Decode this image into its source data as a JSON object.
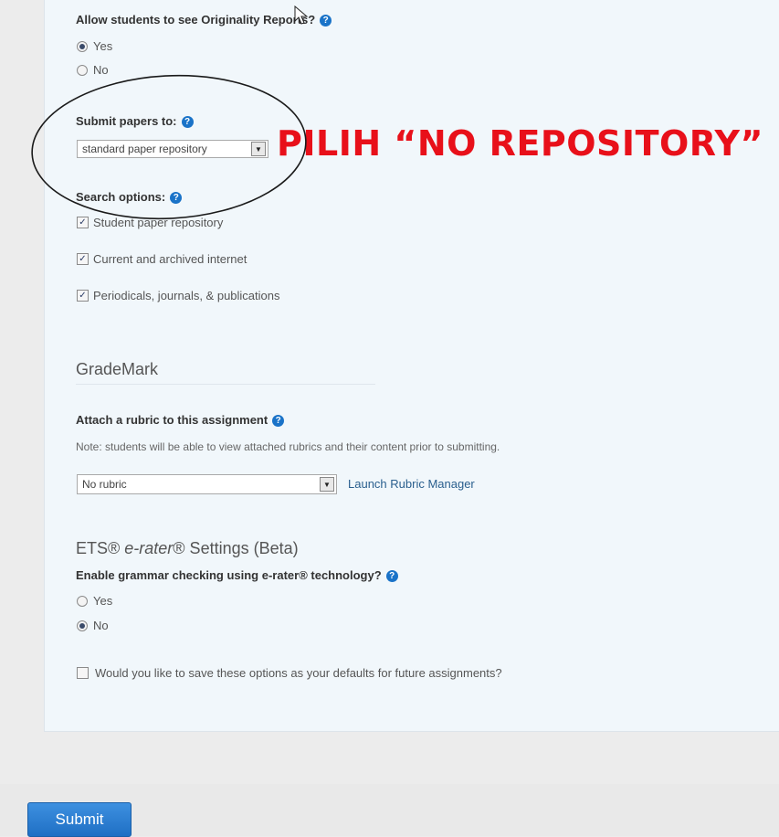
{
  "originality": {
    "question": "Allow students to see Originality Reports?",
    "options": [
      {
        "label": "Yes",
        "checked": true
      },
      {
        "label": "No",
        "checked": false
      }
    ]
  },
  "submit_papers": {
    "label": "Submit papers to:",
    "selected": "standard paper repository"
  },
  "annotation": {
    "text": "PILIH “NO REPOSITORY”",
    "color": "#e8101a"
  },
  "search_options": {
    "label": "Search options:",
    "items": [
      {
        "label": "Student paper repository",
        "checked": true
      },
      {
        "label": "Current and archived internet",
        "checked": true
      },
      {
        "label": "Periodicals, journals, & publications",
        "checked": true
      }
    ]
  },
  "grademark": {
    "title": "GradeMark",
    "rubric_label": "Attach a rubric to this assignment",
    "note": "Note: students will be able to view attached rubrics and their content prior to submitting.",
    "rubric_selected": "No rubric",
    "launch_link": "Launch Rubric Manager"
  },
  "erater": {
    "title_prefix": "ETS® ",
    "title_italic": "e-rater",
    "title_suffix": "® Settings (Beta)",
    "question": "Enable grammar checking using e-rater® technology?",
    "options": [
      {
        "label": "Yes",
        "checked": false
      },
      {
        "label": "No",
        "checked": true
      }
    ]
  },
  "save_defaults": {
    "label": "Would you like to save these options as your defaults for future assignments?",
    "checked": false
  },
  "submit_label": "Submit",
  "colors": {
    "accent": "#1f6fc4",
    "panel": "#f1f7fb"
  }
}
